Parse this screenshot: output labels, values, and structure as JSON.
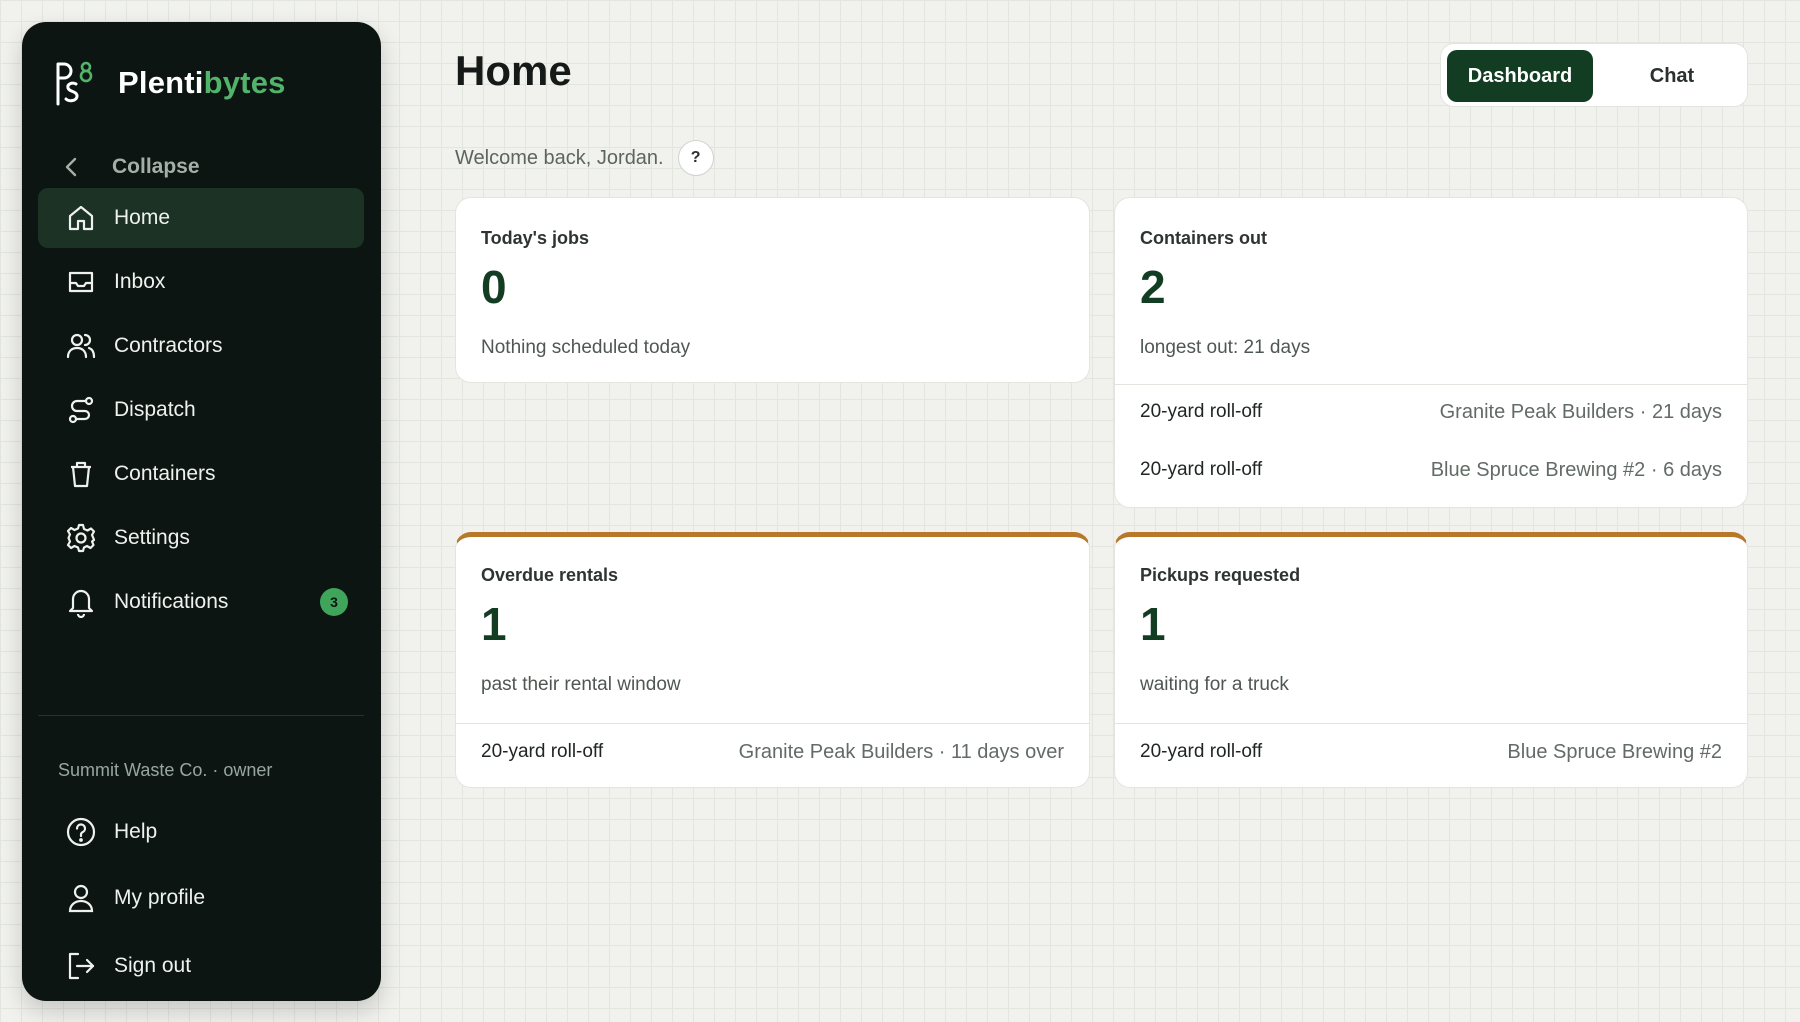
{
  "brand": {
    "name_main": "Plenti",
    "name_accent": "bytes",
    "logo_icon": "ps8-logo-icon"
  },
  "sidebar": {
    "collapse_label": "Collapse",
    "items": [
      {
        "label": "Home",
        "icon": "home-icon",
        "active": true
      },
      {
        "label": "Inbox",
        "icon": "inbox-icon"
      },
      {
        "label": "Contractors",
        "icon": "users-icon"
      },
      {
        "label": "Dispatch",
        "icon": "route-icon"
      },
      {
        "label": "Containers",
        "icon": "trash-bin-icon"
      },
      {
        "label": "Settings",
        "icon": "gear-icon"
      },
      {
        "label": "Notifications",
        "icon": "bell-icon",
        "badge": "3"
      }
    ],
    "org_line": "Summit Waste Co. · owner",
    "footer_items": [
      {
        "label": "Help",
        "icon": "help-circle-icon"
      },
      {
        "label": "My profile",
        "icon": "user-icon"
      },
      {
        "label": "Sign out",
        "icon": "sign-out-icon"
      }
    ]
  },
  "header": {
    "title": "Home",
    "welcome": "Welcome back, Jordan.",
    "help_chip": "?",
    "view_toggle": {
      "active": "Dashboard",
      "inactive": "Chat"
    }
  },
  "cards": {
    "todays_jobs": {
      "title": "Today's jobs",
      "value": "0",
      "subtitle": "Nothing scheduled today"
    },
    "containers_out": {
      "title": "Containers out",
      "value": "2",
      "subtitle": "longest out: 21 days",
      "rows": [
        {
          "left": "20-yard roll-off",
          "right": "Granite Peak Builders · 21 days"
        },
        {
          "left": "20-yard roll-off",
          "right": "Blue Spruce Brewing #2 · 6 days"
        }
      ]
    },
    "overdue_rentals": {
      "title": "Overdue rentals",
      "value": "1",
      "subtitle": "past their rental window",
      "rows": [
        {
          "left": "20-yard roll-off",
          "right": "Granite Peak Builders · 11 days over"
        }
      ]
    },
    "pickups_requested": {
      "title": "Pickups requested",
      "value": "1",
      "subtitle": "waiting for a truck",
      "rows": [
        {
          "left": "20-yard roll-off",
          "right": "Blue Spruce Brewing #2"
        }
      ]
    }
  },
  "colors": {
    "sidebar_bg": "#0d1512",
    "accent_green": "#52b36a",
    "active_nav": "#1b3225",
    "primary_button": "#133d23",
    "warning_border": "#b8782a",
    "badge_green": "#3ea55a"
  }
}
